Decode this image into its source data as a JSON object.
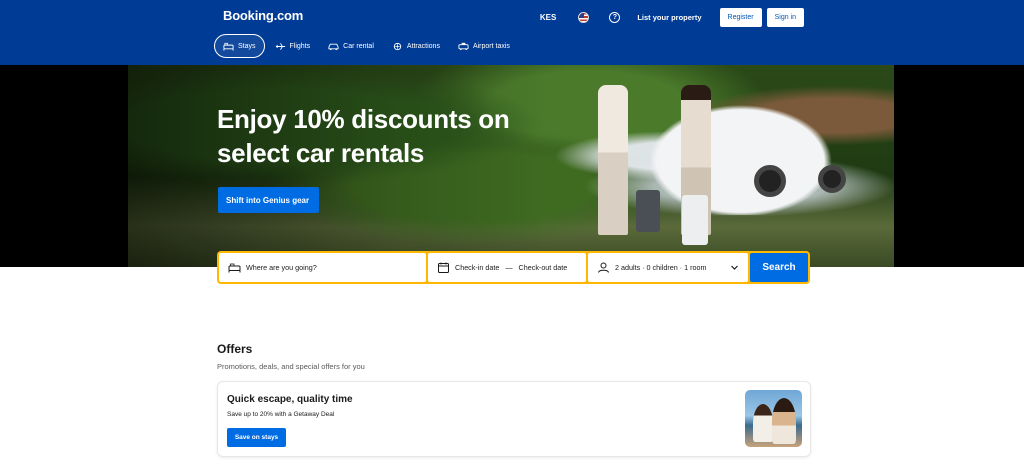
{
  "header": {
    "logo": "Booking.com",
    "currency": "KES",
    "flag_icon": "us-flag-icon",
    "help_icon": "question-circle-icon",
    "list_property": "List your property",
    "register": "Register",
    "sign_in": "Sign in",
    "background_color": "#003b95"
  },
  "nav": {
    "items": [
      {
        "label": "Stays",
        "icon": "bed-icon",
        "active": true
      },
      {
        "label": "Flights",
        "icon": "plane-icon",
        "active": false
      },
      {
        "label": "Car rental",
        "icon": "car-icon",
        "active": false
      },
      {
        "label": "Attractions",
        "icon": "attractions-icon",
        "active": false
      },
      {
        "label": "Airport taxis",
        "icon": "taxi-icon",
        "active": false
      }
    ]
  },
  "hero": {
    "title": "Enjoy 10% discounts on select car rentals",
    "cta": "Shift into Genius gear"
  },
  "search": {
    "destination_placeholder": "Where are you going?",
    "check_in": "Check-in date",
    "dash": "—",
    "check_out": "Check-out date",
    "guests": "2 adults · 0 children · 1 room",
    "button": "Search",
    "border_color": "#ffb700",
    "accent": "#006ce4"
  },
  "offers": {
    "title": "Offers",
    "subtitle": "Promotions, deals, and special offers for you",
    "card": {
      "title": "Quick escape, quality time",
      "subtitle": "Save up to 20% with a Getaway Deal",
      "button": "Save on stays"
    }
  }
}
